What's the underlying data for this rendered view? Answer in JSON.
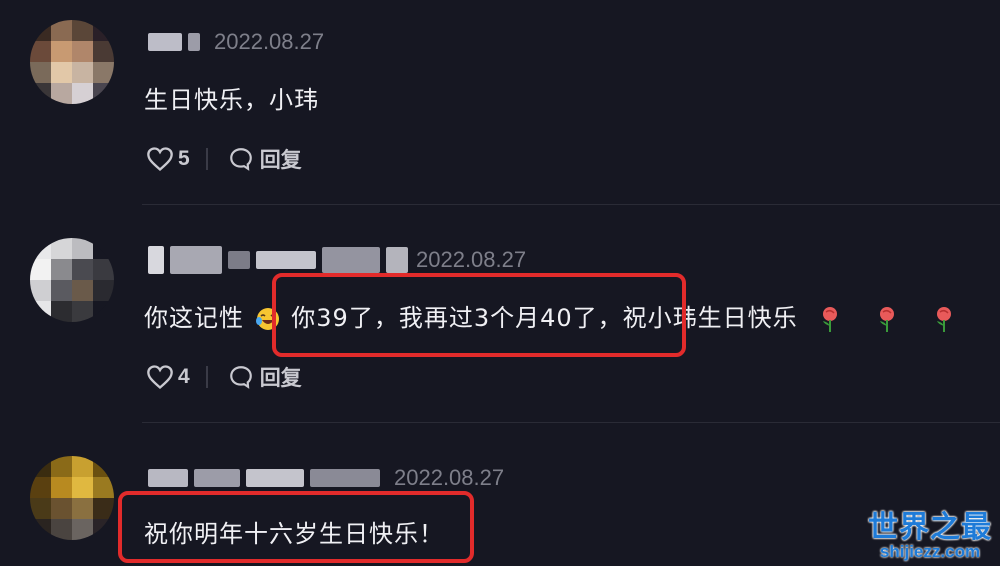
{
  "comments": [
    {
      "date": "2022.08.27",
      "text": "生日快乐，小玮",
      "likes": "5",
      "reply_label": "回复"
    },
    {
      "date": "2022.08.27",
      "text_pre": "你这记性",
      "text_post": "你39了，我再过3个月40了，祝小玮生日快乐",
      "likes": "4",
      "reply_label": "回复"
    },
    {
      "date": "2022.08.27",
      "text": "祝你明年十六岁生日快乐！"
    }
  ],
  "watermark": {
    "title": "世界之最",
    "url": "shijiezz.com"
  },
  "colors": {
    "background": "#161722",
    "highlight": "#e22b2b",
    "watermark": "#1e7bd8"
  },
  "icons": [
    "heart-icon",
    "reply-bubble-icon",
    "laughing-emoji",
    "rose-emoji"
  ]
}
